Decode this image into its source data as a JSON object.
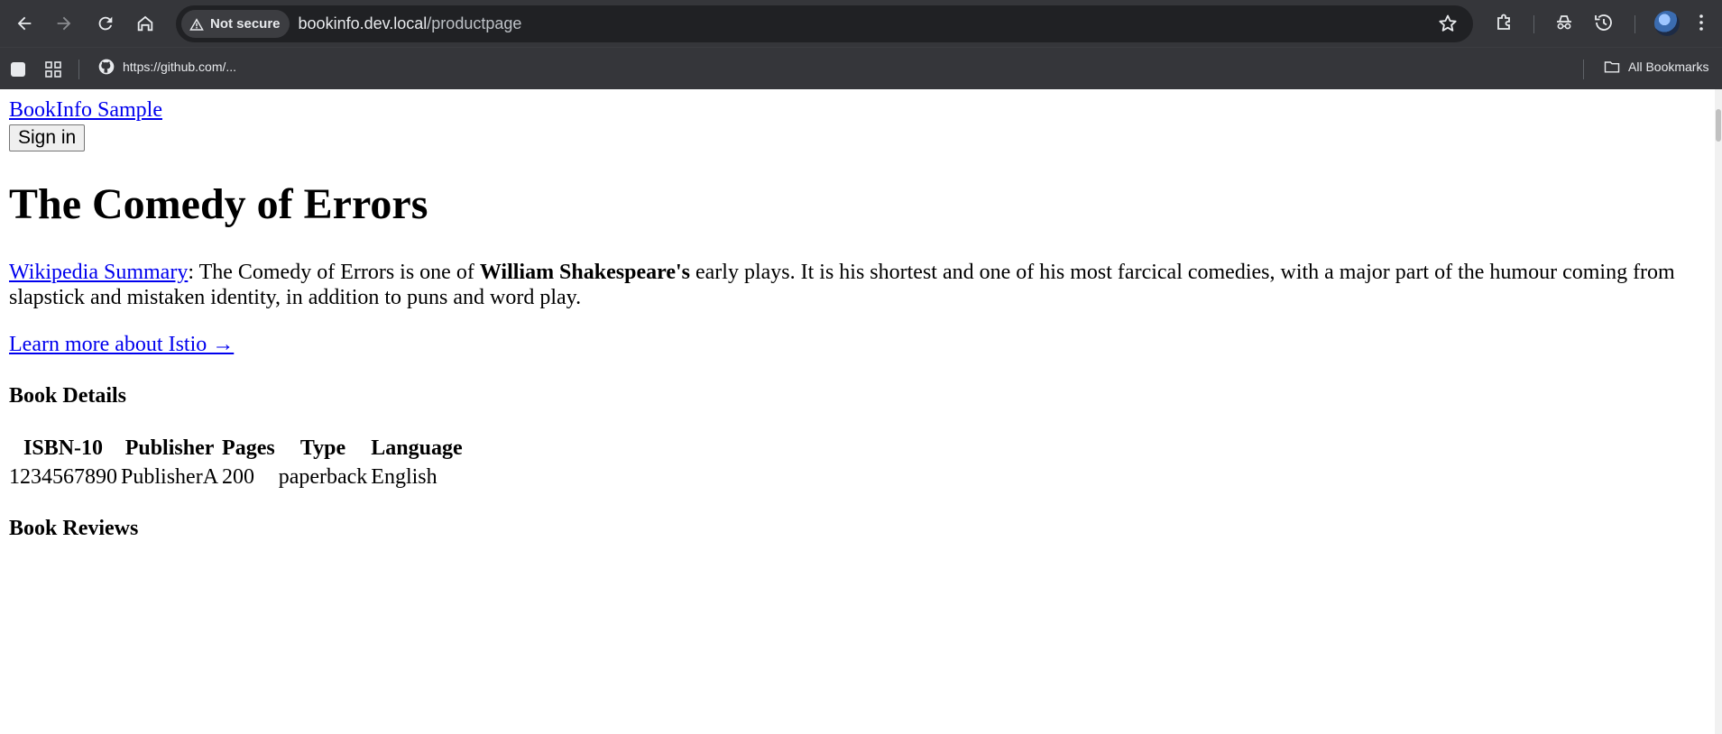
{
  "browser": {
    "security_label": "Not secure",
    "url_host": "bookinfo.dev.local",
    "url_path": "/productpage",
    "bookmark_github": "https://github.com/...",
    "bookmark_all": "All Bookmarks"
  },
  "header": {
    "brand": "BookInfo Sample",
    "signin_label": "Sign in"
  },
  "product": {
    "title": "The Comedy of Errors",
    "summary_link": "Wikipedia Summary",
    "summary_before": ": The Comedy of Errors is one of ",
    "summary_author": "William Shakespeare's",
    "summary_after": " early plays. It is his shortest and one of his most farcical comedies, with a major part of the humour coming from slapstick and mistaken identity, in addition to puns and word play.",
    "learn_more": "Learn more about Istio →"
  },
  "details": {
    "heading": "Book Details",
    "columns": [
      "ISBN-10",
      "Publisher",
      "Pages",
      "Type",
      "Language"
    ],
    "row": [
      "1234567890",
      "PublisherA",
      "200",
      "paperback",
      "English"
    ]
  },
  "reviews": {
    "heading": "Book Reviews"
  }
}
